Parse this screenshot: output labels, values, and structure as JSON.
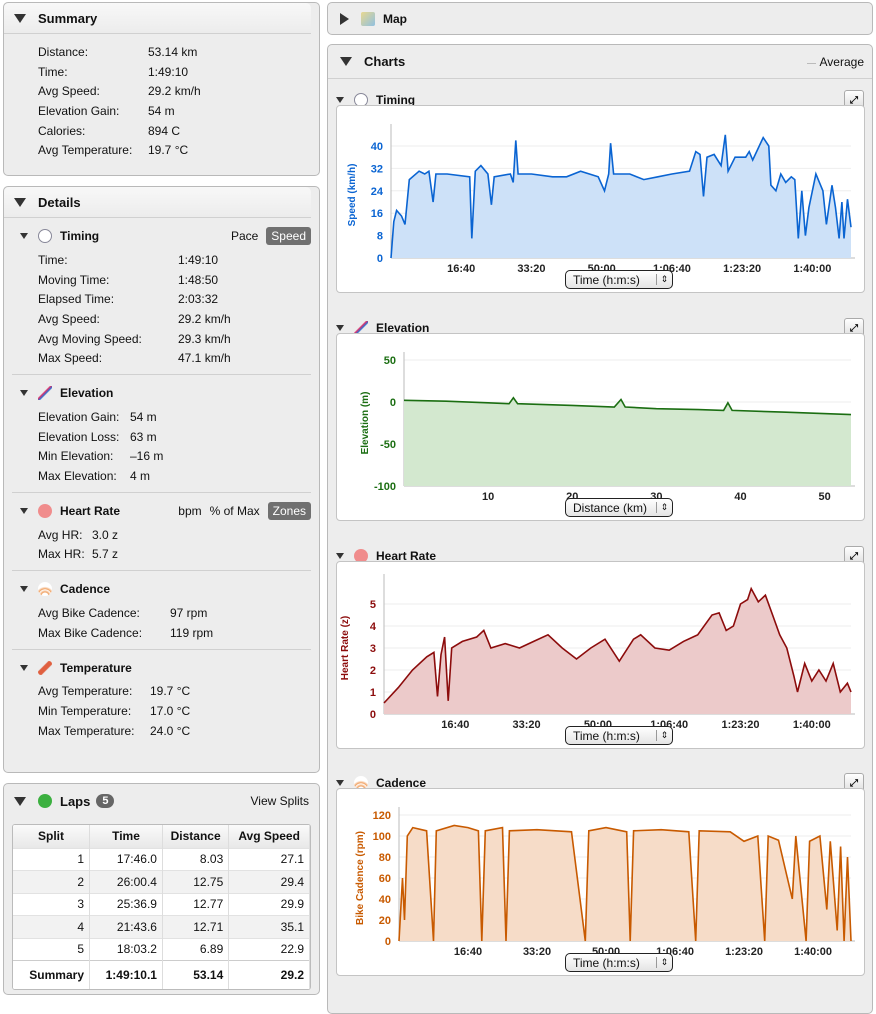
{
  "summary": {
    "title": "Summary",
    "rows": [
      {
        "k": "Distance:",
        "v": "53.14 km"
      },
      {
        "k": "Time:",
        "v": "1:49:10"
      },
      {
        "k": "Avg Speed:",
        "v": "29.2 km/h"
      },
      {
        "k": "Elevation Gain:",
        "v": "54 m"
      },
      {
        "k": "Calories:",
        "v": "894 C"
      },
      {
        "k": "Avg Temperature:",
        "v": "19.7 °C"
      }
    ]
  },
  "details": {
    "title": "Details",
    "timing": {
      "title": "Timing",
      "opt1": "Pace",
      "opt2": "Speed",
      "rows": [
        {
          "k": "Time:",
          "v": "1:49:10"
        },
        {
          "k": "Moving Time:",
          "v": "1:48:50"
        },
        {
          "k": "Elapsed Time:",
          "v": "2:03:32"
        },
        {
          "k": "Avg Speed:",
          "v": "29.2 km/h"
        },
        {
          "k": "Avg Moving Speed:",
          "v": "29.3 km/h"
        },
        {
          "k": "Max Speed:",
          "v": "47.1 km/h"
        }
      ]
    },
    "elevation": {
      "title": "Elevation",
      "rows": [
        {
          "k": "Elevation Gain:",
          "v": "54 m"
        },
        {
          "k": "Elevation Loss:",
          "v": "63 m"
        },
        {
          "k": "Min Elevation:",
          "v": "–16 m"
        },
        {
          "k": "Max Elevation:",
          "v": "4 m"
        }
      ]
    },
    "heart": {
      "title": "Heart Rate",
      "opt1": "bpm",
      "opt2": "% of Max",
      "opt3": "Zones",
      "rows": [
        {
          "k": "Avg HR:",
          "v": "3.0 z"
        },
        {
          "k": "Max HR:",
          "v": "5.7 z"
        }
      ]
    },
    "cadence": {
      "title": "Cadence",
      "rows": [
        {
          "k": "Avg Bike Cadence:",
          "v": "97 rpm"
        },
        {
          "k": "Max Bike Cadence:",
          "v": "119 rpm"
        }
      ]
    },
    "temperature": {
      "title": "Temperature",
      "rows": [
        {
          "k": "Avg Temperature:",
          "v": "19.7 °C"
        },
        {
          "k": "Min Temperature:",
          "v": "17.0 °C"
        },
        {
          "k": "Max Temperature:",
          "v": "24.0 °C"
        }
      ]
    }
  },
  "laps": {
    "title": "Laps",
    "count": "5",
    "view_splits": "View Splits",
    "columns": [
      "Split",
      "Time",
      "Distance",
      "Avg Speed"
    ],
    "rows": [
      [
        "1",
        "17:46.0",
        "8.03",
        "27.1"
      ],
      [
        "2",
        "26:00.4",
        "12.75",
        "29.4"
      ],
      [
        "3",
        "25:36.9",
        "12.77",
        "29.9"
      ],
      [
        "4",
        "21:43.6",
        "12.71",
        "35.1"
      ],
      [
        "5",
        "18:03.2",
        "6.89",
        "22.9"
      ]
    ],
    "summary": [
      "Summary",
      "1:49:10.1",
      "53.14",
      "29.2"
    ]
  },
  "map": {
    "title": "Map"
  },
  "charts": {
    "title": "Charts",
    "average_label": "Average"
  },
  "chart_data": [
    {
      "id": "timing",
      "type": "area",
      "title": "Timing",
      "ylabel": "Speed (km/h)",
      "selector": "Time (h:m:s)",
      "color": "#0a64d2",
      "fill": "#cde1f8",
      "ylim": [
        0,
        45
      ],
      "xlim": [
        0,
        6550
      ],
      "yticks": [
        0,
        8,
        16,
        24,
        32,
        40
      ],
      "xticks": [
        [
          1000,
          "16:40"
        ],
        [
          2000,
          "33:20"
        ],
        [
          3000,
          "50:00"
        ],
        [
          4000,
          "1:06:40"
        ],
        [
          5000,
          "1:23:20"
        ],
        [
          6000,
          "1:40:00"
        ]
      ],
      "points": [
        [
          0,
          0
        ],
        [
          40,
          13
        ],
        [
          80,
          17
        ],
        [
          150,
          15
        ],
        [
          200,
          12
        ],
        [
          260,
          28
        ],
        [
          400,
          31
        ],
        [
          480,
          30
        ],
        [
          540,
          31
        ],
        [
          600,
          20
        ],
        [
          640,
          30
        ],
        [
          800,
          30
        ],
        [
          1120,
          29
        ],
        [
          1150,
          7
        ],
        [
          1200,
          31
        ],
        [
          1280,
          33
        ],
        [
          1380,
          30
        ],
        [
          1430,
          19
        ],
        [
          1470,
          29
        ],
        [
          1700,
          30
        ],
        [
          1740,
          27
        ],
        [
          1777,
          42
        ],
        [
          1810,
          30
        ],
        [
          2000,
          30
        ],
        [
          2300,
          29
        ],
        [
          2500,
          29
        ],
        [
          2700,
          31
        ],
        [
          2950,
          29
        ],
        [
          3040,
          24
        ],
        [
          3100,
          30
        ],
        [
          3127,
          41
        ],
        [
          3170,
          30
        ],
        [
          3400,
          30
        ],
        [
          3600,
          28
        ],
        [
          3800,
          29
        ],
        [
          4000,
          30
        ],
        [
          4250,
          31
        ],
        [
          4340,
          38
        ],
        [
          4400,
          37
        ],
        [
          4450,
          22
        ],
        [
          4500,
          36
        ],
        [
          4600,
          37
        ],
        [
          4700,
          33
        ],
        [
          4760,
          44
        ],
        [
          4800,
          31
        ],
        [
          4900,
          36
        ],
        [
          5050,
          36
        ],
        [
          5100,
          38
        ],
        [
          5150,
          35
        ],
        [
          5300,
          43
        ],
        [
          5380,
          40
        ],
        [
          5410,
          26
        ],
        [
          5480,
          24
        ],
        [
          5550,
          30
        ],
        [
          5620,
          27
        ],
        [
          5700,
          29
        ],
        [
          5750,
          28
        ],
        [
          5800,
          7
        ],
        [
          5850,
          24
        ],
        [
          5900,
          8
        ],
        [
          5950,
          18
        ],
        [
          6050,
          30
        ],
        [
          6150,
          24
        ],
        [
          6200,
          12
        ],
        [
          6280,
          26
        ],
        [
          6330,
          18
        ],
        [
          6380,
          7
        ],
        [
          6420,
          20
        ],
        [
          6450,
          7
        ],
        [
          6500,
          21
        ],
        [
          6530,
          15
        ],
        [
          6550,
          11
        ]
      ]
    },
    {
      "id": "elevation",
      "type": "area",
      "title": "Elevation",
      "ylabel": "Elevation (m)",
      "selector": "Distance (km)",
      "color": "#1b6e12",
      "fill": "#d3e8cf",
      "ylim": [
        -100,
        50
      ],
      "xlim": [
        0,
        53.14
      ],
      "yticks": [
        -100,
        -50,
        0,
        50
      ],
      "xticks": [
        [
          10,
          "10"
        ],
        [
          20,
          "20"
        ],
        [
          30,
          "30"
        ],
        [
          40,
          "40"
        ],
        [
          50,
          "50"
        ]
      ],
      "points": [
        [
          0,
          2
        ],
        [
          5,
          1
        ],
        [
          10,
          -1
        ],
        [
          12.5,
          -2
        ],
        [
          13,
          5
        ],
        [
          13.5,
          -2
        ],
        [
          20,
          -4
        ],
        [
          25,
          -6
        ],
        [
          25.8,
          3
        ],
        [
          26.3,
          -6
        ],
        [
          30,
          -8
        ],
        [
          35,
          -9
        ],
        [
          38,
          -10
        ],
        [
          38.5,
          -1
        ],
        [
          39,
          -10
        ],
        [
          45,
          -12
        ],
        [
          53.14,
          -15
        ]
      ]
    },
    {
      "id": "heart",
      "type": "area",
      "title": "Heart Rate",
      "ylabel": "Heart Rate (z)",
      "selector": "Time (h:m:s)",
      "color": "#8c0c0c",
      "fill": "#eccaca",
      "ylim": [
        0,
        6
      ],
      "xlim": [
        0,
        6550
      ],
      "yticks": [
        0,
        1,
        2,
        3,
        4,
        5
      ],
      "xticks": [
        [
          1000,
          "16:40"
        ],
        [
          2000,
          "33:20"
        ],
        [
          3000,
          "50:00"
        ],
        [
          4000,
          "1:06:40"
        ],
        [
          5000,
          "1:23:20"
        ],
        [
          6000,
          "1:40:00"
        ]
      ],
      "points": [
        [
          0,
          0.5
        ],
        [
          200,
          1.2
        ],
        [
          400,
          2
        ],
        [
          600,
          2.6
        ],
        [
          700,
          2.8
        ],
        [
          750,
          0.8
        ],
        [
          800,
          2.7
        ],
        [
          850,
          3.5
        ],
        [
          900,
          0.6
        ],
        [
          950,
          3.0
        ],
        [
          1100,
          3.3
        ],
        [
          1300,
          3.5
        ],
        [
          1400,
          3.8
        ],
        [
          1500,
          3.0
        ],
        [
          1700,
          3.2
        ],
        [
          1900,
          3.0
        ],
        [
          2100,
          3.3
        ],
        [
          2300,
          3.6
        ],
        [
          2500,
          3.0
        ],
        [
          2700,
          2.5
        ],
        [
          2900,
          3.0
        ],
        [
          3100,
          3.4
        ],
        [
          3300,
          2.4
        ],
        [
          3500,
          3.4
        ],
        [
          3600,
          3.6
        ],
        [
          3800,
          3.0
        ],
        [
          4000,
          2.9
        ],
        [
          4200,
          3.3
        ],
        [
          4400,
          3.6
        ],
        [
          4600,
          4.5
        ],
        [
          4700,
          4.6
        ],
        [
          4800,
          3.8
        ],
        [
          4900,
          4.0
        ],
        [
          5000,
          5.0
        ],
        [
          5100,
          5.2
        ],
        [
          5150,
          5.7
        ],
        [
          5250,
          5.1
        ],
        [
          5350,
          5.4
        ],
        [
          5450,
          4.5
        ],
        [
          5550,
          3.6
        ],
        [
          5650,
          3.0
        ],
        [
          5750,
          1.7
        ],
        [
          5800,
          1.0
        ],
        [
          5900,
          2.3
        ],
        [
          6000,
          1.5
        ],
        [
          6100,
          2.0
        ],
        [
          6200,
          1.5
        ],
        [
          6300,
          2.3
        ],
        [
          6400,
          1.0
        ],
        [
          6500,
          1.4
        ],
        [
          6550,
          1.0
        ]
      ]
    },
    {
      "id": "cadence",
      "type": "area",
      "title": "Cadence",
      "ylabel": "Bike Cadence (rpm)",
      "selector": "Time (h:m:s)",
      "color": "#c85a00",
      "fill": "#f6dcc8",
      "ylim": [
        0,
        120
      ],
      "xlim": [
        0,
        6550
      ],
      "yticks": [
        0,
        20,
        40,
        60,
        80,
        100,
        120
      ],
      "xticks": [
        [
          1000,
          "16:40"
        ],
        [
          2000,
          "33:20"
        ],
        [
          3000,
          "50:00"
        ],
        [
          4000,
          "1:06:40"
        ],
        [
          5000,
          "1:23:20"
        ],
        [
          6000,
          "1:40:00"
        ]
      ],
      "points": [
        [
          0,
          0
        ],
        [
          50,
          60
        ],
        [
          80,
          20
        ],
        [
          120,
          100
        ],
        [
          200,
          108
        ],
        [
          400,
          105
        ],
        [
          500,
          0
        ],
        [
          540,
          105
        ],
        [
          800,
          110
        ],
        [
          1000,
          108
        ],
        [
          1150,
          105
        ],
        [
          1200,
          0
        ],
        [
          1250,
          105
        ],
        [
          1500,
          108
        ],
        [
          1550,
          0
        ],
        [
          1600,
          105
        ],
        [
          2000,
          106
        ],
        [
          2500,
          104
        ],
        [
          2700,
          0
        ],
        [
          2750,
          105
        ],
        [
          3000,
          108
        ],
        [
          3300,
          104
        ],
        [
          3350,
          0
        ],
        [
          3400,
          105
        ],
        [
          3800,
          106
        ],
        [
          4200,
          104
        ],
        [
          4300,
          0
        ],
        [
          4350,
          105
        ],
        [
          4800,
          104
        ],
        [
          5000,
          95
        ],
        [
          5200,
          100
        ],
        [
          5300,
          0
        ],
        [
          5350,
          100
        ],
        [
          5500,
          96
        ],
        [
          5700,
          40
        ],
        [
          5750,
          100
        ],
        [
          5900,
          0
        ],
        [
          5950,
          95
        ],
        [
          6100,
          100
        ],
        [
          6200,
          30
        ],
        [
          6250,
          95
        ],
        [
          6350,
          10
        ],
        [
          6400,
          90
        ],
        [
          6450,
          0
        ],
        [
          6500,
          80
        ],
        [
          6550,
          0
        ]
      ]
    }
  ]
}
